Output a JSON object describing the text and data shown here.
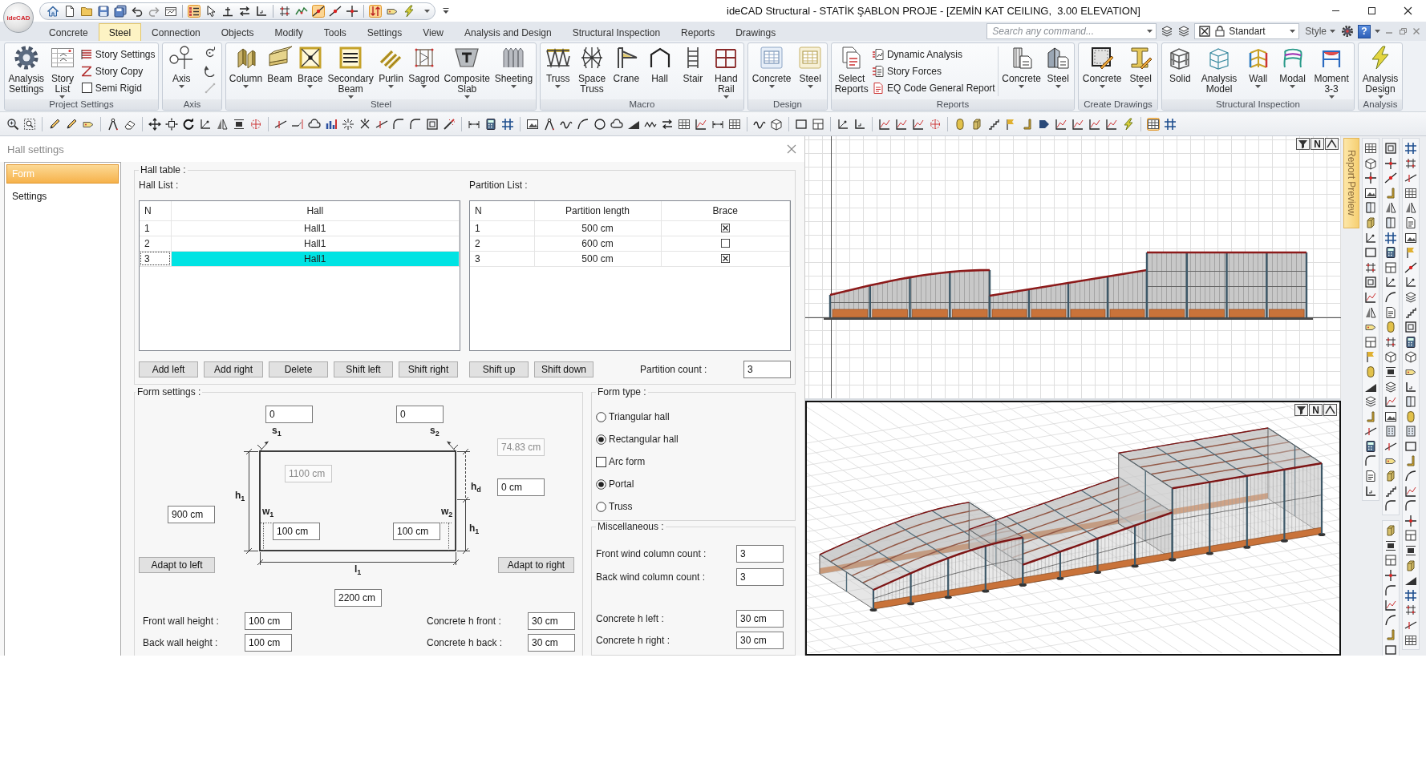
{
  "window": {
    "title": "ideCAD Structural - STATİK ŞABLON PROJE - [ZEMİN KAT CEILING,  3.00 ELEVATION]",
    "logo": "ideCAD"
  },
  "ribbon_tabs": [
    {
      "label": "Concrete",
      "selected": false
    },
    {
      "label": "Steel",
      "selected": true
    },
    {
      "label": "Connection",
      "selected": false
    },
    {
      "label": "Objects",
      "selected": false
    },
    {
      "label": "Modify",
      "selected": false
    },
    {
      "label": "Tools",
      "selected": false
    },
    {
      "label": "Settings",
      "selected": false
    },
    {
      "label": "View",
      "selected": false
    },
    {
      "label": "Analysis and Design",
      "selected": false
    },
    {
      "label": "Structural Inspection",
      "selected": false
    },
    {
      "label": "Reports",
      "selected": false
    },
    {
      "label": "Drawings",
      "selected": false
    }
  ],
  "command_search": {
    "placeholder": "Search any command..."
  },
  "style_combo": {
    "value": "Standart"
  },
  "style_menu": {
    "label": "Style"
  },
  "help_button": {
    "label": "?"
  },
  "ribbon_groups": [
    {
      "title": "Project Settings",
      "items": [
        {
          "kind": "large",
          "label": "Analysis Settings",
          "dropdown": false
        },
        {
          "kind": "large",
          "label": "Story List",
          "dropdown": true
        },
        {
          "kind": "small",
          "label": "Story Settings"
        },
        {
          "kind": "small",
          "label": "Story Copy"
        },
        {
          "kind": "check",
          "label": "Semi Rigid",
          "checked": false
        }
      ]
    },
    {
      "title": "Axis",
      "items": [
        {
          "kind": "large",
          "label": "Axis",
          "dropdown": true
        }
      ]
    },
    {
      "title": "Steel",
      "items": [
        {
          "kind": "large",
          "label": "Column",
          "dropdown": true
        },
        {
          "kind": "large",
          "label": "Beam",
          "dropdown": false
        },
        {
          "kind": "large",
          "label": "Brace",
          "dropdown": true
        },
        {
          "kind": "large",
          "label": "Secondary Beam",
          "dropdown": true
        },
        {
          "kind": "large",
          "label": "Purlin",
          "dropdown": true
        },
        {
          "kind": "large",
          "label": "Sagrod",
          "dropdown": true
        },
        {
          "kind": "large",
          "label": "Composite Slab",
          "dropdown": true
        },
        {
          "kind": "large",
          "label": "Sheeting",
          "dropdown": true
        }
      ]
    },
    {
      "title": "Macro",
      "items": [
        {
          "kind": "large",
          "label": "Truss",
          "dropdown": true
        },
        {
          "kind": "large",
          "label": "Space Truss",
          "dropdown": false
        },
        {
          "kind": "large",
          "label": "Crane",
          "dropdown": false
        },
        {
          "kind": "large",
          "label": "Hall",
          "dropdown": false
        },
        {
          "kind": "large",
          "label": "Stair",
          "dropdown": false
        },
        {
          "kind": "large",
          "label": "Hand Rail",
          "dropdown": true
        }
      ]
    },
    {
      "title": "Design",
      "items": [
        {
          "kind": "large",
          "label": "Concrete",
          "dropdown": true
        },
        {
          "kind": "large",
          "label": "Steel",
          "dropdown": true
        }
      ]
    },
    {
      "title": "Reports",
      "items": [
        {
          "kind": "large",
          "label": "Select Reports",
          "dropdown": false
        },
        {
          "kind": "small",
          "label": "Dynamic Analysis"
        },
        {
          "kind": "small",
          "label": "Story Forces"
        },
        {
          "kind": "small",
          "label": "EQ Code General Report"
        },
        {
          "kind": "large",
          "label": "Concrete",
          "dropdown": true
        },
        {
          "kind": "large",
          "label": "Steel",
          "dropdown": true
        }
      ]
    },
    {
      "title": "Create Drawings",
      "items": [
        {
          "kind": "large",
          "label": "Concrete",
          "dropdown": true
        },
        {
          "kind": "large",
          "label": "Steel",
          "dropdown": true
        }
      ]
    },
    {
      "title": "Structural Inspection",
      "items": [
        {
          "kind": "large",
          "label": "Solid",
          "dropdown": false
        },
        {
          "kind": "large",
          "label": "Analysis Model",
          "dropdown": false
        },
        {
          "kind": "large",
          "label": "Wall",
          "dropdown": true
        },
        {
          "kind": "large",
          "label": "Modal",
          "dropdown": true
        },
        {
          "kind": "large",
          "label": "Moment 3-3",
          "dropdown": true
        }
      ]
    },
    {
      "title": "Analysis",
      "items": [
        {
          "kind": "large",
          "label": "Analysis Design",
          "dropdown": true
        }
      ]
    }
  ],
  "dialog": {
    "title": "Hall settings",
    "nav": [
      {
        "label": "Form",
        "selected": true
      },
      {
        "label": "Settings",
        "selected": false
      }
    ],
    "hall_table": {
      "title": "Hall table :",
      "hall_list": {
        "title": "Hall List :",
        "columns": [
          "N",
          "Hall"
        ],
        "rows": [
          {
            "n": "1",
            "hall": "Hall1",
            "selected": false
          },
          {
            "n": "2",
            "hall": "Hall1",
            "selected": false
          },
          {
            "n": "3",
            "hall": "Hall1",
            "selected": true
          }
        ],
        "buttons": [
          "Add left",
          "Add right",
          "Delete",
          "Shift left",
          "Shift right"
        ]
      },
      "partition_list": {
        "title": "Partition List :",
        "columns": [
          "N",
          "Partition length",
          "Brace"
        ],
        "rows": [
          {
            "n": "1",
            "length": "500 cm",
            "brace": true
          },
          {
            "n": "2",
            "length": "600 cm",
            "brace": false
          },
          {
            "n": "3",
            "length": "500 cm",
            "brace": true
          }
        ],
        "buttons": [
          "Shift up",
          "Shift down"
        ],
        "count": {
          "label": "Partition count :",
          "value": "3"
        }
      }
    },
    "form_settings": {
      "title": "Form settings :",
      "diagram": {
        "labels": [
          "s$_{1}$",
          "s$_{2}$",
          "h$_{1}$",
          "h$_{d}$",
          "w$_{1}$",
          "w$_{2}$",
          "h$_{1}$",
          "l$_{1}$"
        ],
        "fields": [
          {
            "value": "0",
            "disabled": false
          },
          {
            "value": "0",
            "disabled": false
          },
          {
            "value": "74.83 cm",
            "disabled": true
          },
          {
            "value": "1100 cm",
            "disabled": true
          },
          {
            "value": "0 cm",
            "disabled": false
          },
          {
            "value": "900 cm",
            "disabled": false
          },
          {
            "value": "100 cm",
            "disabled": false
          },
          {
            "value": "100 cm",
            "disabled": false
          },
          {
            "value": "2200 cm",
            "disabled": false
          }
        ],
        "buttons": [
          "Adapt to left",
          "Adapt to right"
        ]
      },
      "wall_heights": [
        {
          "label": "Front wall height :",
          "value": "100 cm"
        },
        {
          "label": "Back wall height :",
          "value": "100 cm"
        }
      ],
      "concrete_heights": [
        {
          "label": "Concrete h front :",
          "value": "30 cm"
        },
        {
          "label": "Concrete h back :",
          "value": "30 cm"
        }
      ]
    },
    "form_type": {
      "title": "Form type :",
      "options": [
        {
          "kind": "radio",
          "label": "Triangular hall",
          "checked": false
        },
        {
          "kind": "radio",
          "label": "Rectangular hall",
          "checked": true
        },
        {
          "kind": "checkbox",
          "label": "Arc form",
          "checked": false
        },
        {
          "kind": "radio",
          "label": "Portal",
          "checked": true
        },
        {
          "kind": "radio",
          "label": "Truss",
          "checked": false
        }
      ]
    },
    "miscellaneous": {
      "title": "Miscellaneous :",
      "wind_columns": [
        {
          "label": "Front wind column count :",
          "value": "3"
        },
        {
          "label": "Back wind column count :",
          "value": "3"
        }
      ],
      "concrete_heights": [
        {
          "label": "Concrete h left :",
          "value": "30 cm"
        },
        {
          "label": "Concrete h right :",
          "value": "30 cm"
        }
      ]
    }
  },
  "viewports": [
    {
      "kind": "elevation",
      "corner_label": "N"
    },
    {
      "kind": "perspective",
      "corner_label": "N"
    }
  ],
  "side_tab": {
    "label": "Report Preview"
  }
}
